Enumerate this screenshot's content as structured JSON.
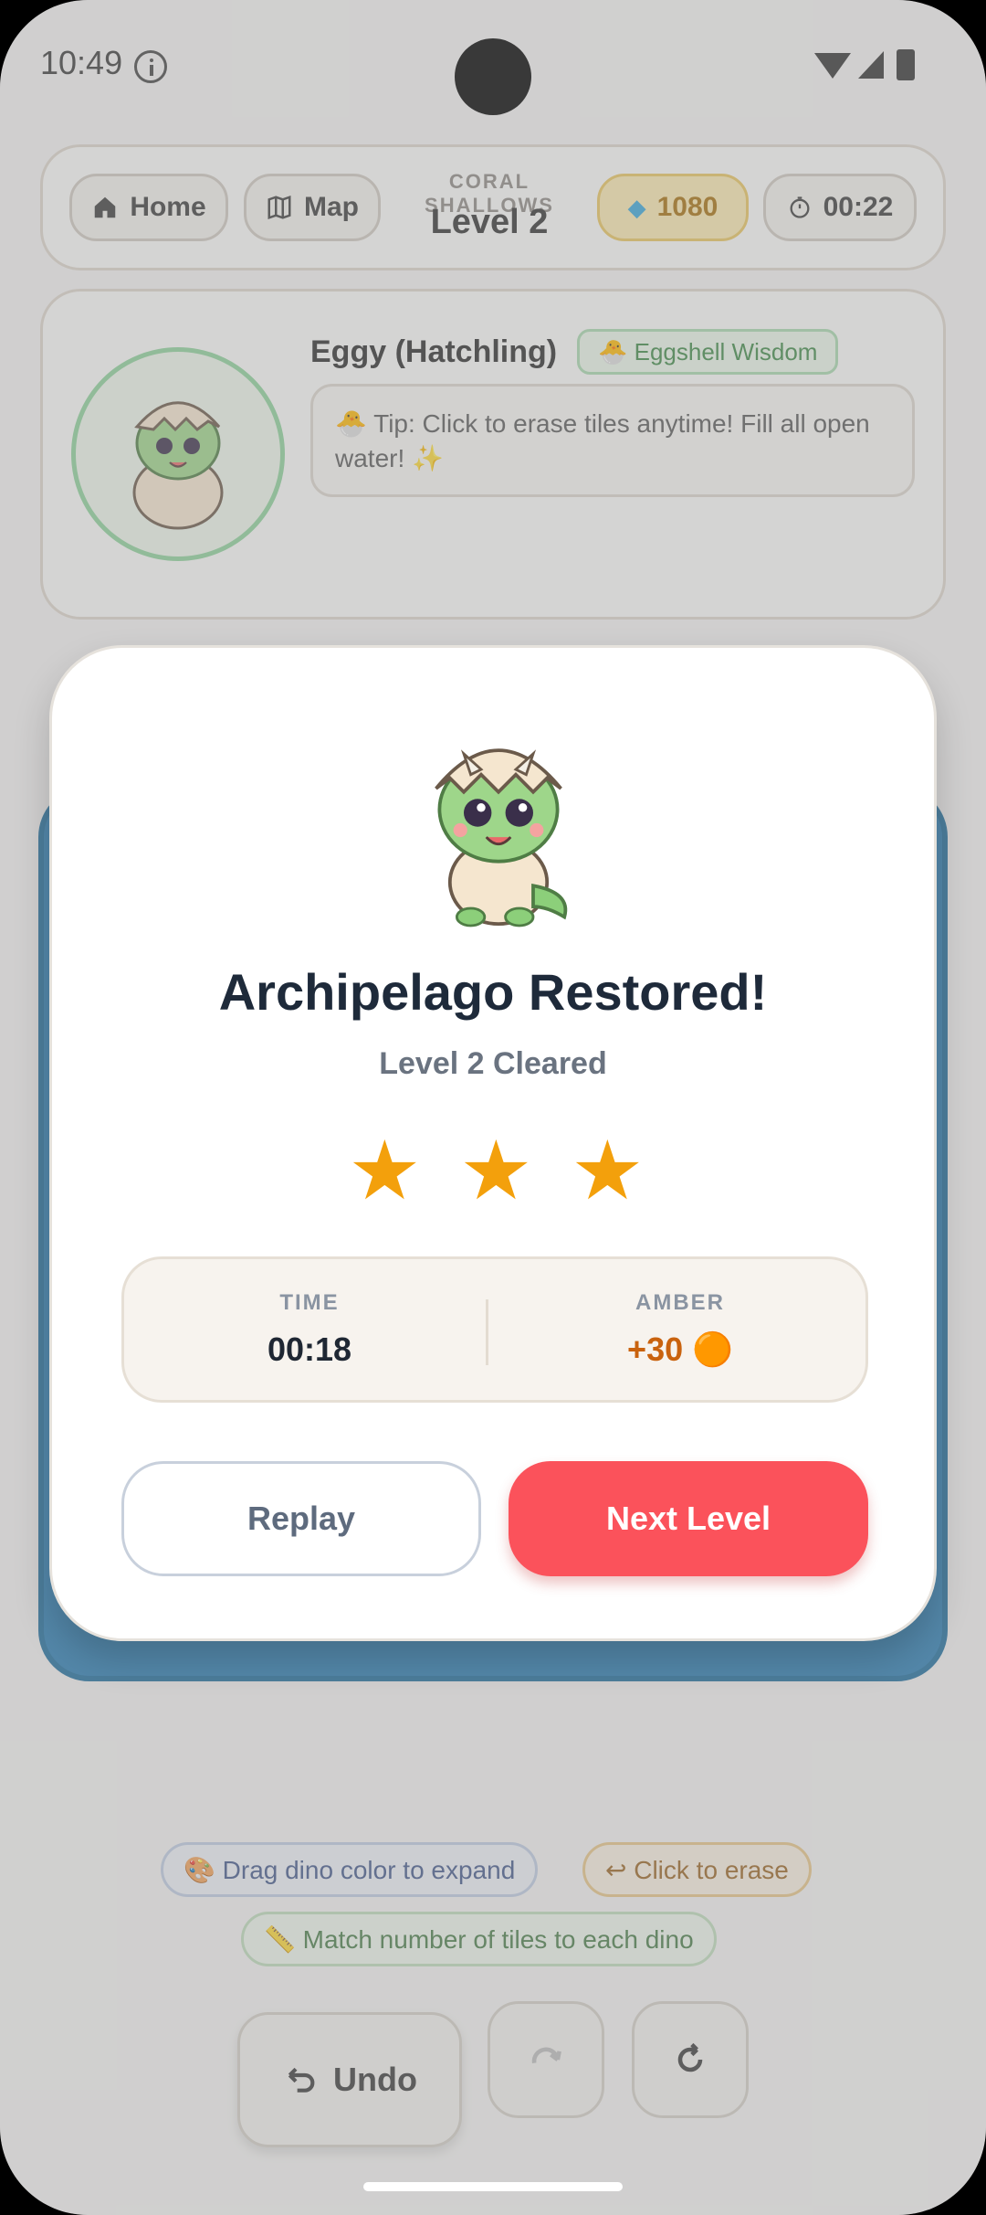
{
  "status_bar": {
    "time": "10:49"
  },
  "header": {
    "home_label": "Home",
    "map_label": "Map",
    "zone": "CORAL SHALLOWS",
    "level": "Level 2",
    "gems": "1080",
    "timer": "00:22"
  },
  "dino_card": {
    "name": "Eggy (Hatchling)",
    "badge": "🐣 Eggshell Wisdom",
    "tip": "🐣 Tip: Click to erase tiles anytime! Fill all open water! ✨"
  },
  "hints": {
    "drag": "🎨 Drag dino color to expand",
    "erase": "↩ Click to erase",
    "match": "📏 Match number of tiles to each dino"
  },
  "controls": {
    "undo_label": "Undo"
  },
  "modal": {
    "title": "Archipelago Restored!",
    "subtitle": "Level 2 Cleared",
    "stars_earned": 3,
    "time_label": "TIME",
    "time_value": "00:18",
    "amber_label": "AMBER",
    "amber_value": "+30 🟠",
    "replay_label": "Replay",
    "next_label": "Next Level"
  },
  "colors": {
    "accent": "#fb525b",
    "star": "#f3a00c",
    "board": "#2b7fb5"
  }
}
